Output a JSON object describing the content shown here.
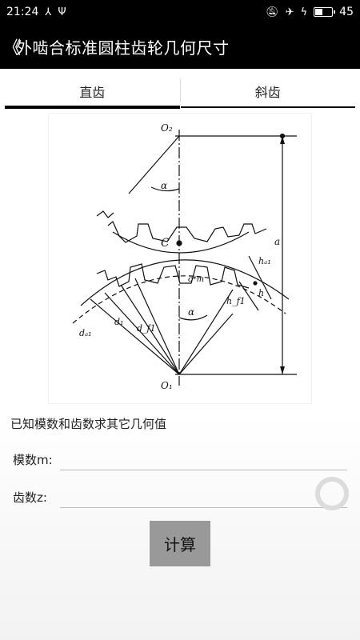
{
  "status_bar": {
    "time": "21:24",
    "left_icons": [
      "share-icon",
      "usb-icon"
    ],
    "right_icons": [
      "mute-icon",
      "airplane-icon",
      "charging-icon",
      "battery-icon"
    ],
    "battery_level": "45",
    "battery_fraction": 0.45
  },
  "app_bar": {
    "back_glyph": "《",
    "title": "外啮合标准圆柱齿轮几何尺寸"
  },
  "tabs": [
    {
      "label": "直齿",
      "active": true
    },
    {
      "label": "斜齿",
      "active": false
    }
  ],
  "diagram": {
    "labels": {
      "o2": "O₂",
      "o1": "O₁",
      "c": "C",
      "alpha_top": "α",
      "alpha_bottom": "α",
      "a": "a",
      "cm": "c*m",
      "ha1": "hₐ₁",
      "hf1": "h_f1",
      "h": "h",
      "d1": "d₁",
      "df1": "d_f1",
      "da1": "dₐ₁"
    }
  },
  "description": "已知模数和齿数求其它几何值",
  "fields": {
    "module_label": "模数m:",
    "module_value": "",
    "teeth_label": "齿数z:",
    "teeth_value": ""
  },
  "calc_button": "计算"
}
